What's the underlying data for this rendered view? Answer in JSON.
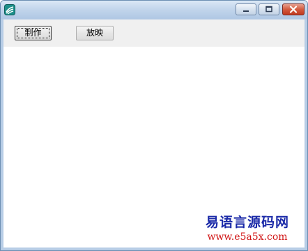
{
  "window": {
    "title": "",
    "icon": "app-swoosh-icon",
    "controls": {
      "minimize": "minimize-icon",
      "maximize": "maximize-icon",
      "close": "close-icon"
    }
  },
  "toolbar": {
    "make_label": "制作",
    "play_label": "放映"
  },
  "watermark": {
    "title": "易语言源码网",
    "url": "www.e5a5x.com"
  },
  "colors": {
    "titlebar": "#c3d6ec",
    "close_button": "#c0391f",
    "toolbar_bg": "#f0f0f0",
    "watermark_title": "#1b2aa8",
    "watermark_url": "#d01414"
  }
}
